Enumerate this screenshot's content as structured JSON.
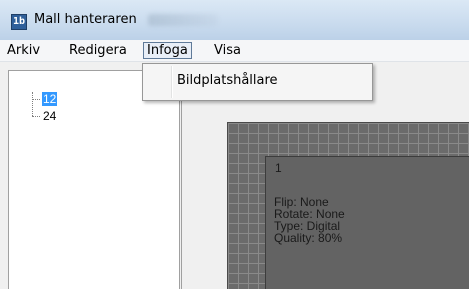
{
  "window": {
    "title": "Mall hanteraren",
    "icon": "app-icon",
    "icon_glyph": "1b"
  },
  "menubar": {
    "items": [
      {
        "label": "Arkiv"
      },
      {
        "label": "Redigera"
      },
      {
        "label": "Infoga",
        "open": true
      },
      {
        "label": "Visa"
      }
    ]
  },
  "dropdown": {
    "items": [
      {
        "label": "Bildplatshållare"
      }
    ]
  },
  "tree": {
    "nodes": [
      {
        "label": "12",
        "selected": true
      },
      {
        "label": "24",
        "selected": false
      }
    ]
  },
  "placeholder": {
    "number": "1",
    "flip": "Flip: None",
    "rotate": "Rotate: None",
    "type": "Type: Digital",
    "quality": "Quality: 80%"
  },
  "colors": {
    "selection": "#3399ff",
    "canvas": "#6b6b6b",
    "placeholder": "#636363"
  }
}
